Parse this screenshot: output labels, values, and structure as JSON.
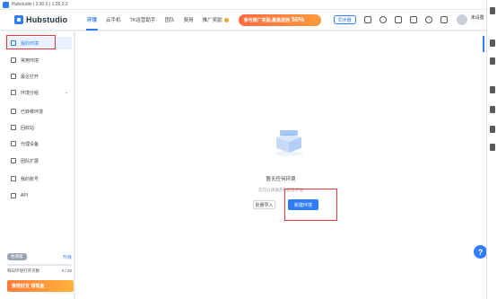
{
  "window": {
    "title": "Hubstudio | 3.30.0 | 1.26.0.2"
  },
  "logo": {
    "text": "Hubstudio"
  },
  "nav": {
    "tabs": [
      {
        "label": "环境"
      },
      {
        "label": "云手机"
      },
      {
        "label": "TK运营助手"
      },
      {
        "label": "团队"
      },
      {
        "label": "费用"
      },
      {
        "label": "推广奖励"
      }
    ],
    "promo": {
      "text": "参与推广奖励,最高返佣",
      "percent": "50%"
    },
    "sync_label": "同步器"
  },
  "user": {
    "name": "未设置",
    "sub": "··· ···"
  },
  "sidebar": {
    "items": [
      {
        "label": "我的环境"
      },
      {
        "label": "常用环境"
      },
      {
        "label": "最近打开"
      },
      {
        "label": "环境分组",
        "chevron": "⌄"
      },
      {
        "label": "已转移环境"
      },
      {
        "label": "回收站"
      },
      {
        "label": "代理设备"
      },
      {
        "label": "团队扩展"
      },
      {
        "label": "我的账号"
      },
      {
        "label": "API"
      }
    ],
    "quota": {
      "plan": "免费版",
      "upgrade": "升级",
      "label": "每日环境打开次数",
      "value": "0 / 20"
    },
    "banner": "推荐好友 领现金"
  },
  "main": {
    "empty_title": "暂无任何环境",
    "empty_sub": "您可以快速开始新建环境",
    "batch_import": "批量导入",
    "new_env": "新建环境",
    "help": "?"
  },
  "colors": {
    "accent": "#2f7dfc",
    "highlight": "#e53935",
    "promo": "#ff6a3d"
  }
}
